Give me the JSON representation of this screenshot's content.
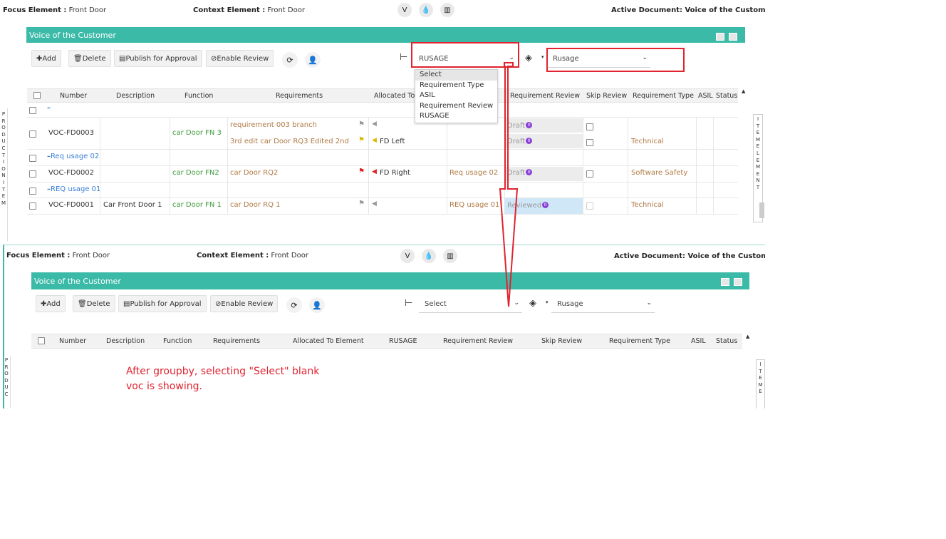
{
  "top": {
    "focus_label": "Focus Element :",
    "focus_value": "Front Door",
    "context_label": "Context Element :",
    "context_value": "Front Door",
    "active_doc": "Active Document: Voice of the Customer"
  },
  "panel": {
    "title": "Voice of the Customer",
    "toolbar": {
      "add": "Add",
      "delete": "Delete",
      "publish": "Publish for Approval",
      "enable_review": "Enable Review"
    },
    "groupby_value_top": "RUSAGE",
    "groupby_value_bottom": "Select",
    "filter_value": "Rusage",
    "dropdown_options": [
      "Select",
      "Requirement Type",
      "ASIL",
      "Requirement Review",
      "RUSAGE"
    ]
  },
  "grid_top": {
    "headers": [
      "Number",
      "Description",
      "Function",
      "Requirements",
      "Allocated To",
      "Requirement Review",
      "Skip Review",
      "Requirement Type",
      "ASIL",
      "Status"
    ],
    "group_1_label": "–",
    "row1": {
      "number": "VOC-FD0003",
      "function": "car Door FN 3",
      "req_a": "requirement 003 branch",
      "req_b": "3rd edit car Door RQ3 Edited 2nd",
      "alloc_b": "FD Left",
      "review_a": "Draft",
      "review_b": "Draft",
      "type_b": "Technical"
    },
    "group_2_label": "Req usage 02",
    "row2": {
      "number": "VOC-FD0002",
      "function": "car Door FN2",
      "req": "car Door RQ2",
      "alloc": "FD Right",
      "rusage": "Req usage 02",
      "review": "Draft",
      "type": "Software Safety"
    },
    "group_3_label": "REQ usage 01",
    "row3": {
      "number": "VOC-FD0001",
      "description": "Car Front Door 1",
      "function": "car Door FN 1",
      "req": "car Door RQ 1",
      "rusage": "REQ usage 01",
      "review": "Reviewed",
      "type": "Technical"
    },
    "badge": "0"
  },
  "grid_bottom": {
    "headers": [
      "Number",
      "Description",
      "Function",
      "Requirements",
      "Allocated To Element",
      "RUSAGE",
      "Requirement Review",
      "Skip Review",
      "Requirement Type",
      "ASIL",
      "Status"
    ]
  },
  "side_labels": {
    "left_top": "P R O D U C T I O N I T E M",
    "right_top": "I T E M E L E M E N T",
    "left_bottom": "P R O D U C",
    "right_bottom": "I T E M E"
  },
  "annotation": {
    "line1": "After groupby, selecting \"Select\" blank",
    "line2": "voc is showing."
  },
  "icons": [
    "vine-icon",
    "drop-icon",
    "chart-icon",
    "refresh-icon",
    "assign-user-icon",
    "groupby-icon",
    "layers-icon",
    "flag-icon",
    "comment-icon",
    "grid-icon"
  ],
  "colors": {
    "teal": "#3cbaa8",
    "red_annotation": "#e0232f",
    "green_text": "#3c9a3c",
    "brown_text": "#b07a45",
    "blue_text": "#3a7fd6",
    "badge": "#8a3fd6"
  }
}
